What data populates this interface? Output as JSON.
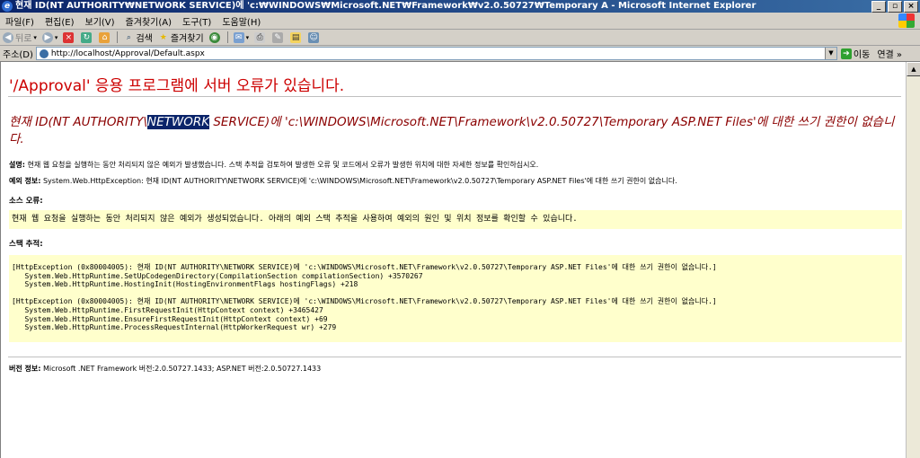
{
  "window": {
    "title": "현재 ID(NT AUTHORITY₩NETWORK SERVICE)에 'c:₩WINDOWS₩Microsoft.NET₩Framework₩v2.0.50727₩Temporary A - Microsoft Internet Explorer",
    "minimize": "_",
    "restore": "▫",
    "close": "×"
  },
  "menu": [
    "파일(F)",
    "편집(E)",
    "보기(V)",
    "즐겨찾기(A)",
    "도구(T)",
    "도움말(H)"
  ],
  "toolbar": {
    "back": "뒤로",
    "search": "검색",
    "favorites": "즐겨찾기"
  },
  "address": {
    "label": "주소(D)",
    "url": "http://localhost/Approval/Default.aspx",
    "go": "이동",
    "links": "연결 »"
  },
  "page": {
    "heading": "'/Approval' 응용 프로그램에 서버 오류가 있습니다.",
    "message_pre": "현재 ID(NT AUTHORITY\\",
    "message_sel": "NETWORK",
    "message_post": " SERVICE)에 'c:\\WINDOWS\\Microsoft.NET\\Framework\\v2.0.50727\\Temporary ASP.NET Files'에 대한 쓰기 권한이 없습니다.",
    "desc_label": "설명:",
    "desc_text": " 현재 웹 요청을 실행하는 동안 처리되지 않은 예외가 발생했습니다. 스택 추적을 검토하여 발생한 오류 및 코드에서 오류가 발생한 위치에 대한 자세한 정보를 확인하십시오.",
    "exc_label": "예외 정보:",
    "exc_text": " System.Web.HttpException: 현재 ID(NT AUTHORITY\\NETWORK SERVICE)에 'c:\\WINDOWS\\Microsoft.NET\\Framework\\v2.0.50727\\Temporary ASP.NET Files'에 대한 쓰기 권한이 없습니다.",
    "source_label": "소스 오류:",
    "source_text": "현재 웹 요청을 실행하는 동안 처리되지 않은 예외가 생성되었습니다. 아래의 예외 스택 추적을 사용하여 예외의 원인 및 위치 정보를 확인할 수 있습니다.",
    "stack_label": "스택 추적:",
    "stack_text": "[HttpException (0x80004005): 현재 ID(NT AUTHORITY\\NETWORK SERVICE)에 'c:\\WINDOWS\\Microsoft.NET\\Framework\\v2.0.50727\\Temporary ASP.NET Files'에 대한 쓰기 권한이 없습니다.]\n   System.Web.HttpRuntime.SetUpCodegenDirectory(CompilationSection compilationSection) +3570267\n   System.Web.HttpRuntime.HostingInit(HostingEnvironmentFlags hostingFlags) +218\n\n[HttpException (0x80004005): 현재 ID(NT AUTHORITY\\NETWORK SERVICE)에 'c:\\WINDOWS\\Microsoft.NET\\Framework\\v2.0.50727\\Temporary ASP.NET Files'에 대한 쓰기 권한이 없습니다.]\n   System.Web.HttpRuntime.FirstRequestInit(HttpContext context) +3465427\n   System.Web.HttpRuntime.EnsureFirstRequestInit(HttpContext context) +69\n   System.Web.HttpRuntime.ProcessRequestInternal(HttpWorkerRequest wr) +279",
    "version_label": "버전 정보:",
    "version_text": " Microsoft .NET Framework 버전:2.0.50727.1433; ASP.NET 버전:2.0.50727.1433"
  }
}
